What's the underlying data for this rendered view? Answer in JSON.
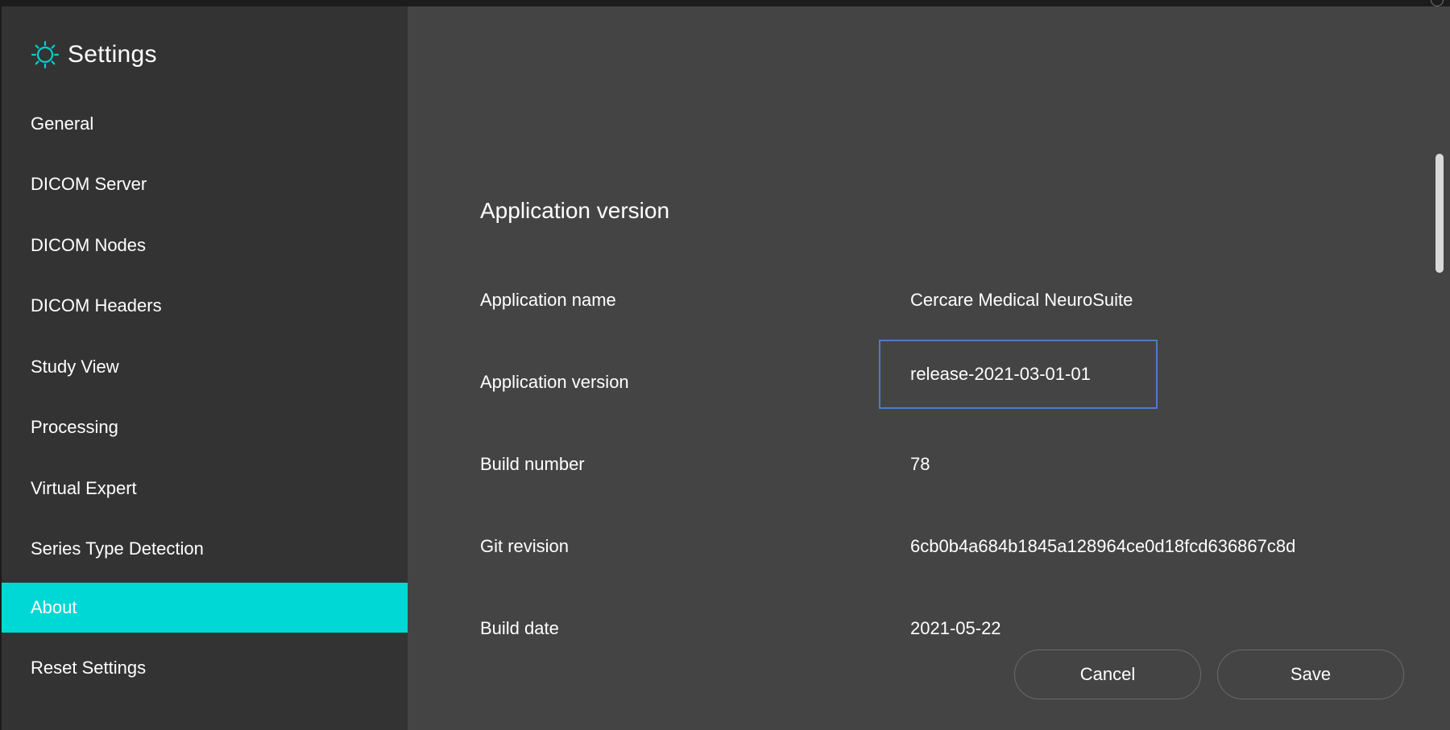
{
  "sidebar": {
    "title": "Settings",
    "icon": "settings-gear-icon",
    "items": [
      {
        "label": "General"
      },
      {
        "label": "DICOM Server"
      },
      {
        "label": "DICOM Nodes"
      },
      {
        "label": "DICOM Headers"
      },
      {
        "label": "Study View"
      },
      {
        "label": "Processing"
      },
      {
        "label": "Virtual Expert"
      },
      {
        "label": "Series Type Detection"
      },
      {
        "label": "About",
        "active": true
      },
      {
        "label": "Reset Settings"
      }
    ]
  },
  "main": {
    "section_title": "Application version",
    "rows": [
      {
        "label": "Application name",
        "value": "Cercare Medical NeuroSuite"
      },
      {
        "label": "Application version",
        "value": "release-2021-03-01-01"
      },
      {
        "label": "Build number",
        "value": "78"
      },
      {
        "label": "Git revision",
        "value": "6cb0b4a684b1845a128964ce0d18fcd636867c8d"
      },
      {
        "label": "Build date",
        "value": "2021-05-22"
      }
    ]
  },
  "footer": {
    "cancel_label": "Cancel",
    "save_label": "Save"
  },
  "colors": {
    "accent": "#00d8d6",
    "sidebar_bg": "#333333",
    "content_bg": "#444444",
    "focus_border": "#4a7ec2"
  }
}
